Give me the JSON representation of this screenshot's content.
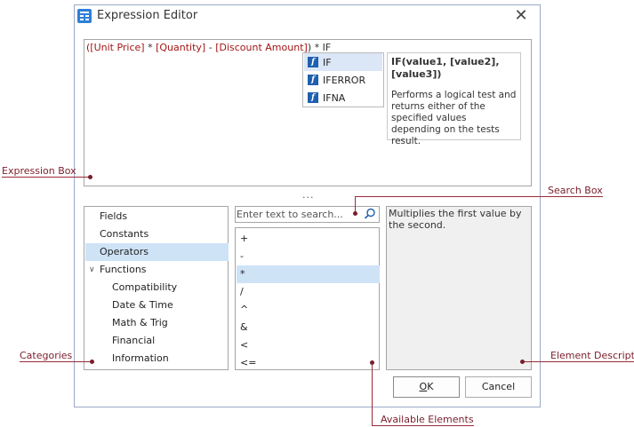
{
  "dialog": {
    "title": "Expression Editor",
    "close_glyph": "✕"
  },
  "expression": {
    "tokens": [
      {
        "text": "([Unit Price]",
        "kind": "field"
      },
      {
        "text": " * ",
        "kind": "op"
      },
      {
        "text": "[Quantity]",
        "kind": "field"
      },
      {
        "text": " - ",
        "kind": "op"
      },
      {
        "text": "[Discount Amount]",
        "kind": "field"
      },
      {
        "text": ") * IF",
        "kind": "op"
      }
    ]
  },
  "autocomplete": {
    "icon_glyph": "f",
    "items": [
      {
        "label": "IF",
        "selected": true
      },
      {
        "label": "IFERROR",
        "selected": false
      },
      {
        "label": "IFNA",
        "selected": false
      }
    ]
  },
  "tooltip": {
    "title": "IF(value1, [value2], [value3])",
    "description": "Performs a logical test and returns either of the specified values depending on the tests result."
  },
  "splitter_glyph": "...",
  "categories": [
    {
      "label": "Fields",
      "level": 0,
      "selected": false,
      "expander": ""
    },
    {
      "label": "Constants",
      "level": 0,
      "selected": false,
      "expander": ""
    },
    {
      "label": "Operators",
      "level": 0,
      "selected": true,
      "expander": ""
    },
    {
      "label": "Functions",
      "level": 0,
      "selected": false,
      "expander": "∨"
    },
    {
      "label": "Compatibility",
      "level": 1,
      "selected": false,
      "expander": ""
    },
    {
      "label": "Date & Time",
      "level": 1,
      "selected": false,
      "expander": ""
    },
    {
      "label": "Math & Trig",
      "level": 1,
      "selected": false,
      "expander": ""
    },
    {
      "label": "Financial",
      "level": 1,
      "selected": false,
      "expander": ""
    },
    {
      "label": "Information",
      "level": 1,
      "selected": false,
      "expander": ""
    }
  ],
  "search": {
    "placeholder": "Enter text to search..."
  },
  "elements": [
    {
      "label": "+",
      "selected": false
    },
    {
      "label": "-",
      "selected": false
    },
    {
      "label": "*",
      "selected": true
    },
    {
      "label": "/",
      "selected": false
    },
    {
      "label": "^",
      "selected": false
    },
    {
      "label": "&",
      "selected": false
    },
    {
      "label": "<",
      "selected": false
    },
    {
      "label": "<=",
      "selected": false
    }
  ],
  "description": "Multiplies the first value by the second.",
  "buttons": {
    "ok": "OK",
    "ok_mnemonic_index": 0,
    "cancel": "Cancel"
  },
  "callouts": {
    "expression_box": "Expression Box",
    "search_box": "Search Box",
    "categories": "Categories",
    "element_description": "Element Description",
    "available_elements": "Available Elements"
  },
  "colors": {
    "field_token": "#a31515",
    "selection": "#cfe3f7",
    "callout": "#7a1e2a",
    "function_icon": "#1f5fb0"
  }
}
